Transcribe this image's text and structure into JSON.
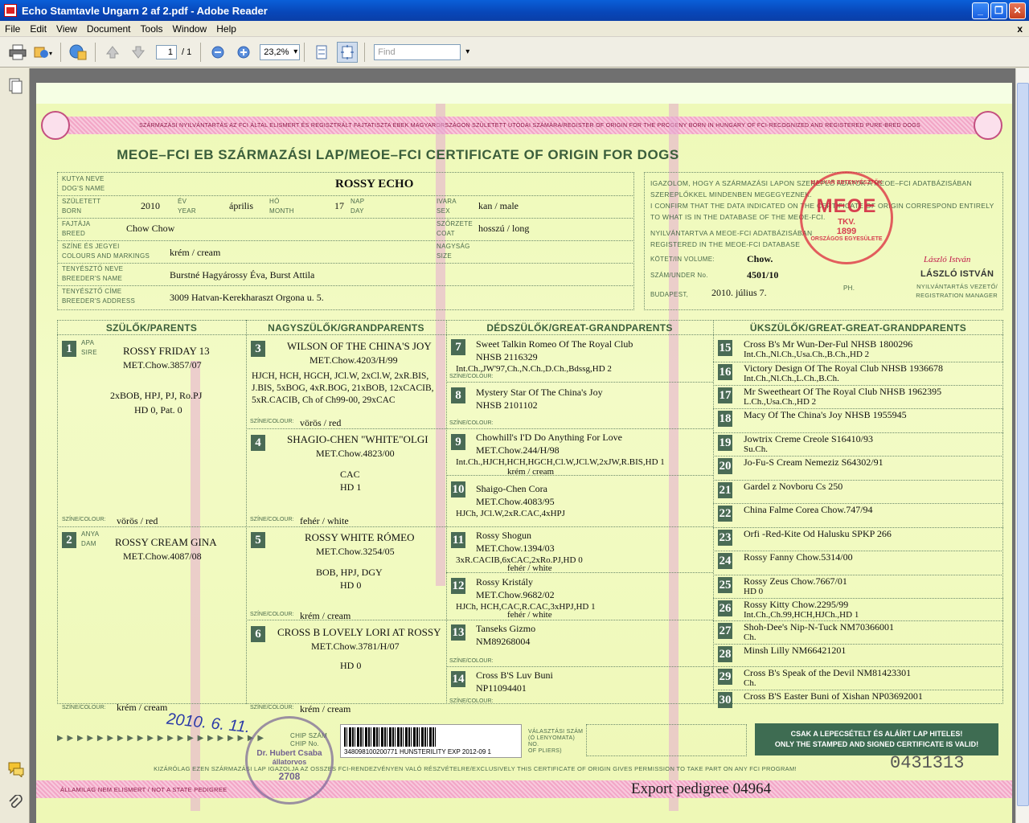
{
  "window": {
    "title": "Echo Stamtavle Ungarn 2 af 2.pdf - Adobe Reader"
  },
  "menu": [
    "File",
    "Edit",
    "View",
    "Document",
    "Tools",
    "Window",
    "Help"
  ],
  "menu_close": "x",
  "toolbar": {
    "page_current": "1",
    "page_total": "/ 1",
    "zoom": "23,2%",
    "find_placeholder": "Find"
  },
  "cert": {
    "top_band": "SZÁRMAZÁSI NYILVÁNTARTÁS AZ FCI ÁLTAL ELISMERT ÉS REGISZTRÁLT FAJTATISZTA EBEK MAGYARORSZÁGON SZÜLETETT UTÓDAI SZÁMÁRA/REGISTER OF ORIGIN FOR THE PROGENY BORN IN HUNGARY OF FCI-RECOGNIZED AND REGISTERED PURE-BRED DOGS",
    "title": "MEOE–FCI EB SZÁRMAZÁSI LAP/MEOE–FCI CERTIFICATE OF ORIGIN FOR DOGS",
    "labels": {
      "dog_name": "KUTYA NEVE\nDOG'S NAME",
      "born": "SZÜLETETT\nBORN",
      "year": "ÉV\nYEAR",
      "month": "HÓ\nMONTH",
      "day": "NAP\nDAY",
      "sex": "IVARA\nSEX",
      "breed": "FAJTÁJA\nBREED",
      "coat": "SZŐRZETE\nCOAT",
      "colours": "SZÍNE ÉS JEGYEI\nCOLOURS AND MARKINGS",
      "size": "NAGYSÁG\nSIZE",
      "breeder_name": "TENYÉSZTŐ NEVE\nBREEDER'S NAME",
      "breeder_address": "TENYÉSZTŐ CÍME\nBREEDER'S ADDRESS",
      "volume": "KÖTET/IN VOLUME:",
      "under_no": "SZÁM/UNDER No.",
      "budapest": "BUDAPEST,",
      "sire": "APA\nSIRE",
      "dam": "ANYA\nDAM",
      "colour": "SZÍNE/COLOUR:"
    },
    "dog": {
      "name": "ROSSY ECHO",
      "year": "2010",
      "month": "április",
      "day": "17",
      "sex": "kan / male",
      "breed": "Chow Chow",
      "coat": "hosszú / long",
      "colours": "krém / cream",
      "breeder_name": "Burstné Hagyárossy Éva, Burst Attila",
      "breeder_address": "3009 Hatvan-Kerekharaszt Orgona u. 5."
    },
    "confirm_text": "IGAZOLOM, HOGY A SZÁRMAZÁSI LAPON SZEREPLŐ ADATOK A MEOE–FCI ADATBÁZISÁBAN SZEREPLŐKKEL MINDENBEN MEGEGYEZNEK.\nI CONFIRM THAT THE DATA INDICATED ON THE CERTIFICATE OF ORIGIN CORRESPOND ENTIRELY TO WHAT IS IN THE DATABASE OF THE MEOE-FCI.",
    "registered_text": "NYILVÁNTARTVA A MEOE-FCI ADATBÁZISÁBAN\nREGISTERED IN THE MEOE-FCI DATABASE",
    "volume": "Chow.",
    "under_no": "4501/10",
    "date": "2010. július 7.",
    "ph": "PH.",
    "signature": "László István",
    "manager_name": "LÁSZLÓ ISTVÁN",
    "manager_title": "NYILVÁNTARTÁS VEZETŐ/\nREGISTRATION MANAGER",
    "seal": {
      "top": "MAGYAR EBTENYÉSZTŐK",
      "bottom": "ORSZÁGOS EGYESÜLETE",
      "mid": "MEOE",
      "tkv": "TKV.",
      "year": "1899"
    },
    "col_heads": [
      "SZÜLŐK/PARENTS",
      "NAGYSZÜLŐK/GRANDPARENTS",
      "DÉDSZÜLŐK/GREAT-GRANDPARENTS",
      "ÜKSZÜLŐK/GREAT-GREAT-GRANDPARENTS"
    ],
    "parents": [
      {
        "n": "1",
        "name": "ROSSY FRIDAY 13",
        "reg": "MET.Chow.3857/07",
        "titles": "2xBOB, HPJ, PJ, Ro.PJ",
        "hd": "HD 0, Pat. 0",
        "colour": "vörös / red"
      },
      {
        "n": "2",
        "name": "ROSSY CREAM GINA",
        "reg": "MET.Chow.4087/08",
        "colour": "krém / cream"
      }
    ],
    "grand": [
      {
        "n": "3",
        "name": "WILSON OF THE CHINA'S JOY",
        "reg": "MET.Chow.4203/H/99",
        "titles": "HJCH, HCH, HGCH, JCl.W, 2xCl.W, 2xR.BIS, J.BIS, 5xBOG, 4xR.BOG, 21xBOB, 12xCACIB, 5xR.CACIB, Ch of Ch99-00, 29xCAC",
        "colour": "vörös / red"
      },
      {
        "n": "4",
        "name": "SHAGIO-CHEN \"WHITE\"OLGI",
        "reg": "MET.Chow.4823/00",
        "t1": "CAC",
        "t2": "HD 1",
        "colour": "fehér / white"
      },
      {
        "n": "5",
        "name": "ROSSY WHITE RÓMEO",
        "reg": "MET.Chow.3254/05",
        "t1": "BOB, HPJ, DGY",
        "t2": "HD 0",
        "colour": "krém / cream"
      },
      {
        "n": "6",
        "name": "CROSS B LOVELY LORI AT ROSSY",
        "reg": "MET.Chow.3781/H/07",
        "t2": "HD 0",
        "colour": "krém / cream"
      }
    ],
    "great": [
      {
        "n": "7",
        "l1": "Sweet Talkin Romeo Of The Royal Club",
        "l2": "NHSB 2116329",
        "l3": "Int.Ch.,JW'97,Ch.,N.Ch.,D.Ch.,Bdssg,HD 2"
      },
      {
        "n": "8",
        "l1": "Mystery Star Of The China's Joy",
        "l2": "NHSB 2101102",
        "l3": ""
      },
      {
        "n": "9",
        "l1": "Chowhill's I'D Do Anything For Love",
        "l2": "MET.Chow.244/H/98",
        "l3": "Int.Ch.,HJCH,HCH,HGCH,Cl.W,JCl.W,2xJW,R.BIS,HD 1",
        "c": "krém / cream"
      },
      {
        "n": "10",
        "l1": "Shaigo-Chen Cora",
        "l2": "MET.Chow.4083/95",
        "l3": "HJCh, JCl.W,2xR.CAC,4xHPJ"
      },
      {
        "n": "11",
        "l1": "Rossy Shogun",
        "l2": "MET.Chow.1394/03",
        "l3": "3xR.CACIB,6xCAC,2xRo.PJ,HD 0",
        "c": "fehér / white"
      },
      {
        "n": "12",
        "l1": "Rossy Kristály",
        "l2": "MET.Chow.9682/02",
        "l3": "HJCh, HCH,CAC,R.CAC,3xHPJ,HD 1",
        "c": "fehér / white"
      },
      {
        "n": "13",
        "l1": "Tanseks Gizmo",
        "l2": "NM89268004",
        "l3": ""
      },
      {
        "n": "14",
        "l1": "Cross B'S Luv Buni",
        "l2": "NP11094401",
        "l3": ""
      }
    ],
    "ggreat": [
      {
        "n": "15",
        "l1": "Cross B's Mr Wun-Der-Ful NHSB 1800296",
        "l2": "Int.Ch.,Nl.Ch.,Usa.Ch.,B.Ch.,HD 2"
      },
      {
        "n": "16",
        "l1": "Victory Design Of The Royal Club NHSB 1936678",
        "l2": "Int.Ch.,Nl.Ch.,L.Ch.,B.Ch."
      },
      {
        "n": "17",
        "l1": "Mr Sweetheart Of The Royal Club NHSB 1962395",
        "l2": "L.Ch.,Usa.Ch.,HD 2"
      },
      {
        "n": "18",
        "l1": "Macy Of The China's Joy NHSB 1955945",
        "l2": ""
      },
      {
        "n": "19",
        "l1": "Jowtrix Creme Creole S16410/93",
        "l2": "Su.Ch."
      },
      {
        "n": "20",
        "l1": "Jo-Fu-S Cream Nemeziz S64302/91",
        "l2": ""
      },
      {
        "n": "21",
        "l1": "Gardel z Novboru Cs 250",
        "l2": ""
      },
      {
        "n": "22",
        "l1": "China Falme Corea Chow.747/94",
        "l2": ""
      },
      {
        "n": "23",
        "l1": "Orfi -Red-Kite Od Halusku SPKP 266",
        "l2": ""
      },
      {
        "n": "24",
        "l1": "Rossy Fanny Chow.5314/00",
        "l2": ""
      },
      {
        "n": "25",
        "l1": "Rossy Zeus Chow.7667/01",
        "l2": "HD 0"
      },
      {
        "n": "26",
        "l1": "Rossy Kitty Chow.2295/99",
        "l2": "Int.Ch.,Ch.99,HCH,HJCh.,HD 1"
      },
      {
        "n": "27",
        "l1": "Shoh-Dee's Nip-N-Tuck NM70366001",
        "l2": "Ch."
      },
      {
        "n": "28",
        "l1": "Minsh Lilly NM66421201",
        "l2": ""
      },
      {
        "n": "29",
        "l1": "Cross B's Speak of the Devil NM81423301",
        "l2": "Ch."
      },
      {
        "n": "30",
        "l1": "Cross B'S Easter Buni of Xishan NP03692001",
        "l2": ""
      }
    ],
    "chip_label": "CHIP SZÁM\nCHIP No.",
    "barcode_text": "348098100200771   HUNSTERILITY EXP 2012-09   1",
    "tattoo_label": "VÁLASZTÁSI SZÁM\n(Ó LENYOMATA)\nNO.\nOF PLIERS)",
    "green_notice": "CSAK A LEPECSÉTELT ÉS ALÁÍRT LAP HITELES!\nONLY THE STAMPED AND SIGNED CERTIFICATE IS VALID!",
    "bottom_band_1": "KIZÁRÓLAG EZEN SZÁRMAZÁSI LAP IGAZOLJA AZ OSSZES FCI-RENDEZVÉNYEN VALÓ RÉSZVÉTELRE/EXCLUSIVELY THIS CERTIFICATE OF ORIGIN GIVES PERMISSION TO TAKE PART ON ANY FCI PROGRAM!",
    "bottom_band_2": "ÁLLAMILAG NEM ELISMERT / NOT A STATE PEDIGREE",
    "serial": "0431313",
    "export": "Export pedigree 04964",
    "vet_stamp": {
      "name": "Dr. Hubert Csaba",
      "role": "állatorvos",
      "num": "2708"
    },
    "handwritten_date": "2010. 6. 11."
  }
}
